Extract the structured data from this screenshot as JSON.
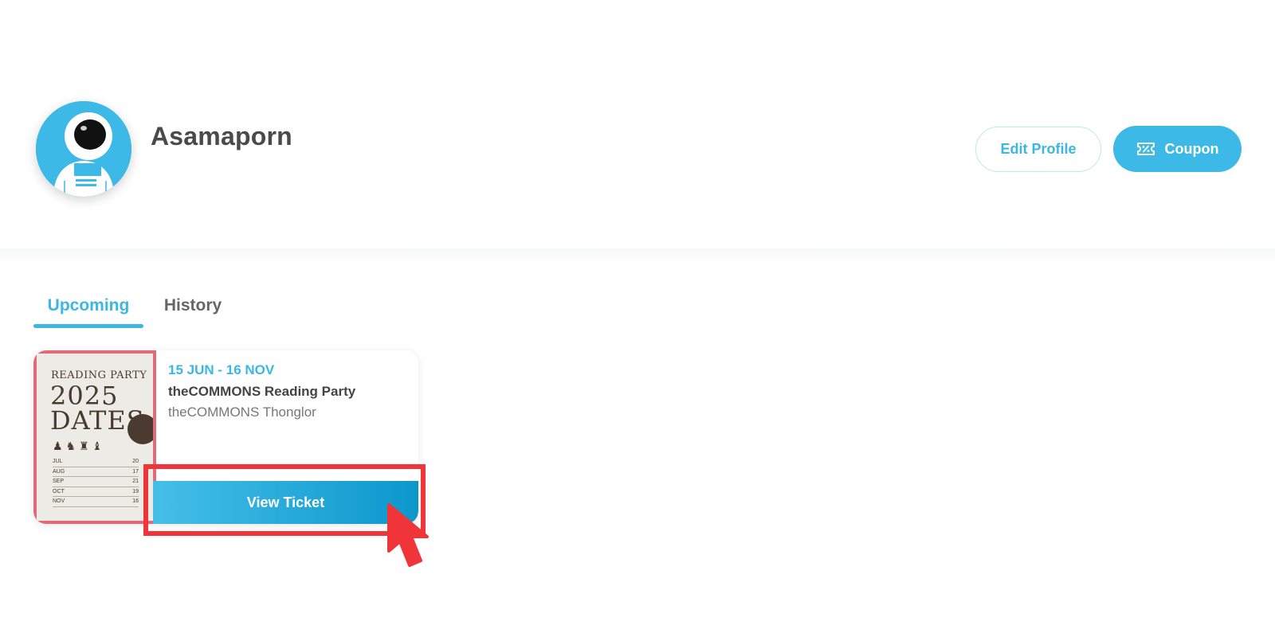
{
  "profile": {
    "name": "Asamaporn",
    "avatar_icon": "astronaut-icon",
    "edit_label": "Edit Profile",
    "coupon_label": "Coupon",
    "coupon_icon": "coupon-ticket-icon"
  },
  "tabs": [
    {
      "label": "Upcoming",
      "active": true
    },
    {
      "label": "History",
      "active": false
    }
  ],
  "events": [
    {
      "date": "15 JUN - 16 NOV",
      "title": "theCOMMONS Reading Party",
      "venue": "theCOMMONS Thonglor",
      "view_label": "View Ticket",
      "poster": {
        "line1": "READING PARTY",
        "year": "2025",
        "word": "DATES",
        "rows": [
          {
            "month": "JUL",
            "day": "20"
          },
          {
            "month": "AUG",
            "day": "17"
          },
          {
            "month": "SEP",
            "day": "21"
          },
          {
            "month": "OCT",
            "day": "19"
          },
          {
            "month": "NOV",
            "day": "16"
          }
        ]
      }
    }
  ],
  "colors": {
    "accent": "#3cb9e6",
    "highlight": "#f0353a",
    "poster_border": "#e06a78"
  }
}
